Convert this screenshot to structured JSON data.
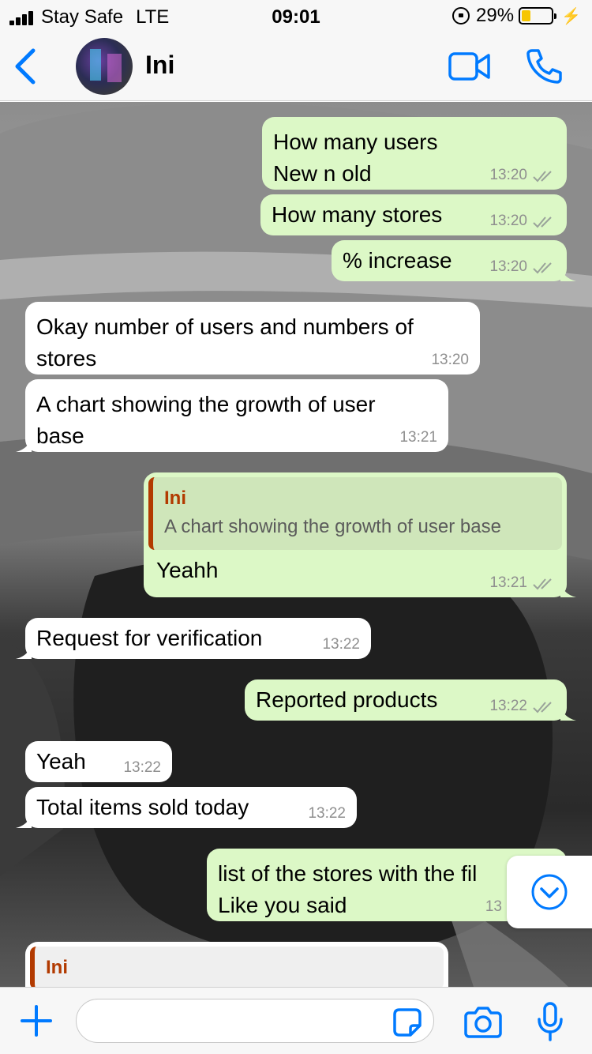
{
  "status_bar": {
    "carrier": "Stay Safe",
    "network": "LTE",
    "time": "09:01",
    "battery": "29%",
    "battery_level": 0.29
  },
  "header": {
    "contact_name": "Ini",
    "back_icon": "chevron-left-icon",
    "video_icon": "video-camera-icon",
    "call_icon": "phone-icon"
  },
  "messages": [
    {
      "dir": "out",
      "text": "How many users\nNew n old",
      "time": "13:20",
      "status": "read"
    },
    {
      "dir": "out",
      "text": "How many stores",
      "time": "13:20",
      "status": "read"
    },
    {
      "dir": "out",
      "text": "% increase",
      "time": "13:20",
      "status": "read"
    },
    {
      "dir": "in",
      "text": "Okay number of users and numbers of\nstores",
      "time": "13:20"
    },
    {
      "dir": "in",
      "text": "A chart showing the growth of user\nbase",
      "time": "13:21"
    },
    {
      "dir": "out",
      "quote_author": "Ini",
      "quote_text": "A chart showing the growth of user base",
      "text": "Yeahh",
      "time": "13:21",
      "status": "read"
    },
    {
      "dir": "in",
      "text": "Request for verification",
      "time": "13:22"
    },
    {
      "dir": "out",
      "text": "Reported products",
      "time": "13:22",
      "status": "read"
    },
    {
      "dir": "in",
      "text": "Yeah",
      "time": "13:22"
    },
    {
      "dir": "in",
      "text": "Total items sold today",
      "time": "13:22"
    },
    {
      "dir": "out",
      "text": "list of the stores with the fil\nLike you said",
      "time": "13"
    },
    {
      "dir": "in",
      "quote_author": "Ini"
    }
  ],
  "input": {
    "placeholder": "",
    "value": ""
  },
  "colors": {
    "outgoing_bubble": "#dcf8c6",
    "incoming_bubble": "#ffffff",
    "accent": "#007aff",
    "quote_author": "#b23a00"
  }
}
